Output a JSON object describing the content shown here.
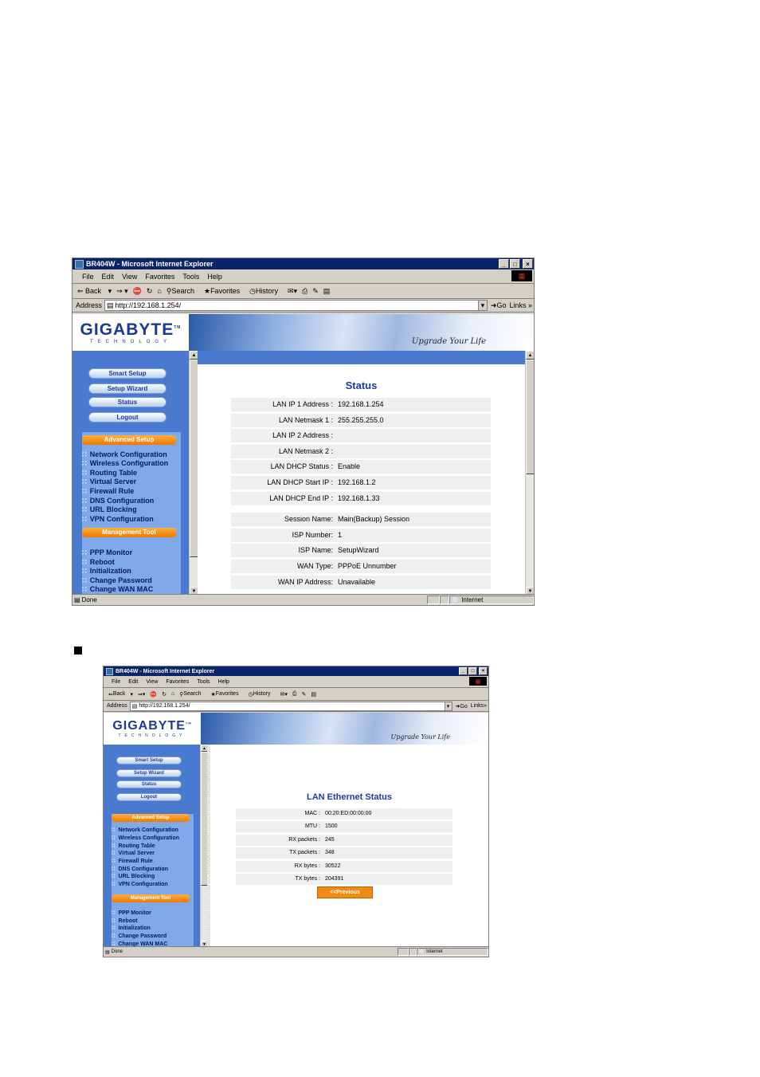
{
  "window": {
    "title": "BR404W - Microsoft Internet Explorer",
    "title_buttons": [
      "_",
      "□",
      "×"
    ],
    "menu": [
      "File",
      "Edit",
      "View",
      "Favorites",
      "Tools",
      "Help"
    ],
    "toolbar": {
      "back": "Back",
      "search": "Search",
      "favorites": "Favorites",
      "history": "History"
    },
    "address_label": "Address",
    "address_value": "http://192.168.1.254/",
    "go_label": "Go",
    "links_label": "Links",
    "status_left": "Done",
    "status_zone": "Internet"
  },
  "brand": {
    "logo": "GIGABYTE",
    "tm": "TM",
    "sub": "TECHNOLOGY",
    "slogan": "Upgrade Your Life"
  },
  "sidebar": {
    "buttons": [
      "Smart Setup",
      "Setup Wizard",
      "Status",
      "Logout"
    ],
    "advanced_header": "Advanced Setup",
    "advanced_items": [
      "Network Configuration",
      "Wireless Configuration",
      "Routing Table",
      "Virtual Server",
      "Firewall Rule",
      "DNS Configuration",
      "URL Blocking",
      "VPN Configuration"
    ],
    "management_header": "Management Tool",
    "management_items": [
      "PPP Monitor",
      "Reboot",
      "Initialization",
      "Change Password",
      "Change WAN MAC"
    ]
  },
  "status_page": {
    "title": "Status",
    "rows": [
      {
        "label": "LAN IP 1 Address :",
        "value": "192.168.1.254"
      },
      {
        "label": "LAN Netmask 1 :",
        "value": "255.255.255.0"
      },
      {
        "label": "LAN IP 2 Address :",
        "value": ""
      },
      {
        "label": "LAN Netmask 2 :",
        "value": ""
      },
      {
        "label": "LAN DHCP Status :",
        "value": "Enable"
      },
      {
        "label": "LAN DHCP Start IP :",
        "value": "192.168.1.2"
      },
      {
        "label": "LAN DHCP End IP :",
        "value": "192.168.1.33"
      },
      {
        "label": "Session Name:",
        "value": "Main(Backup) Session"
      },
      {
        "label": "ISP Number:",
        "value": "1"
      },
      {
        "label": "ISP Name:",
        "value": "SetupWizard"
      },
      {
        "label": "WAN Type:",
        "value": "PPPoE Unnumber"
      },
      {
        "label": "WAN IP Address:",
        "value": "Unavailable"
      }
    ]
  },
  "lan_page": {
    "title": "LAN Ethernet Status",
    "rows": [
      {
        "label": "MAC :",
        "value": "00:20:ED:00:00:00"
      },
      {
        "label": "MTU :",
        "value": "1500"
      },
      {
        "label": "RX packets :",
        "value": "245"
      },
      {
        "label": "TX packets :",
        "value": "348"
      },
      {
        "label": "RX bytes :",
        "value": "30522"
      },
      {
        "label": "TX bytes :",
        "value": "204391"
      }
    ],
    "previous_button": "<<Previous"
  }
}
